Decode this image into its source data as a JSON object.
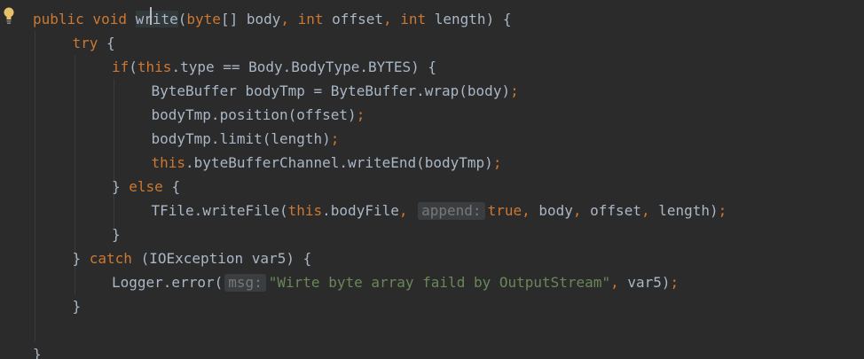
{
  "editor": {
    "lines": [
      {
        "indent": 0,
        "tokens": [
          {
            "t": "public void ",
            "c": "kw"
          },
          {
            "t": "write",
            "c": "hl"
          },
          {
            "t": "(",
            "c": ""
          },
          {
            "t": "byte",
            "c": "kw"
          },
          {
            "t": "[] body",
            "c": ""
          },
          {
            "t": ", ",
            "c": "kw"
          },
          {
            "t": "int ",
            "c": "kw"
          },
          {
            "t": "offset",
            "c": ""
          },
          {
            "t": ", ",
            "c": "kw"
          },
          {
            "t": "int ",
            "c": "kw"
          },
          {
            "t": "length) {",
            "c": ""
          }
        ]
      },
      {
        "indent": 1,
        "tokens": [
          {
            "t": "try ",
            "c": "kw"
          },
          {
            "t": "{",
            "c": ""
          }
        ]
      },
      {
        "indent": 2,
        "tokens": [
          {
            "t": "if",
            "c": "kw"
          },
          {
            "t": "(",
            "c": ""
          },
          {
            "t": "this",
            "c": "kw"
          },
          {
            "t": ".type == Body.BodyType.BYTES) {",
            "c": ""
          }
        ]
      },
      {
        "indent": 3,
        "tokens": [
          {
            "t": "ByteBuffer bodyTmp = ByteBuffer.wrap(body)",
            "c": ""
          },
          {
            "t": ";",
            "c": "kw"
          }
        ]
      },
      {
        "indent": 3,
        "tokens": [
          {
            "t": "bodyTmp.position(offset)",
            "c": ""
          },
          {
            "t": ";",
            "c": "kw"
          }
        ]
      },
      {
        "indent": 3,
        "tokens": [
          {
            "t": "bodyTmp.limit(length)",
            "c": ""
          },
          {
            "t": ";",
            "c": "kw"
          }
        ]
      },
      {
        "indent": 3,
        "tokens": [
          {
            "t": "this",
            "c": "kw"
          },
          {
            "t": ".byteBufferChannel.writeEnd(bodyTmp)",
            "c": ""
          },
          {
            "t": ";",
            "c": "kw"
          }
        ]
      },
      {
        "indent": 2,
        "tokens": [
          {
            "t": "} ",
            "c": ""
          },
          {
            "t": "else ",
            "c": "kw"
          },
          {
            "t": "{",
            "c": ""
          }
        ]
      },
      {
        "indent": 3,
        "tokens": [
          {
            "t": "TFile.writeFile(",
            "c": ""
          },
          {
            "t": "this",
            "c": "kw"
          },
          {
            "t": ".bodyFile",
            "c": ""
          },
          {
            "t": ", ",
            "c": "kw"
          },
          {
            "t": "append:",
            "c": "hint"
          },
          {
            "t": "true",
            "c": "kw"
          },
          {
            "t": ", ",
            "c": "kw"
          },
          {
            "t": "body",
            "c": ""
          },
          {
            "t": ", ",
            "c": "kw"
          },
          {
            "t": "offset",
            "c": ""
          },
          {
            "t": ", ",
            "c": "kw"
          },
          {
            "t": "length)",
            "c": ""
          },
          {
            "t": ";",
            "c": "kw"
          }
        ]
      },
      {
        "indent": 2,
        "tokens": [
          {
            "t": "}",
            "c": ""
          }
        ]
      },
      {
        "indent": 1,
        "tokens": [
          {
            "t": "} ",
            "c": ""
          },
          {
            "t": "catch ",
            "c": "kw"
          },
          {
            "t": "(IOException var5) {",
            "c": ""
          }
        ]
      },
      {
        "indent": 2,
        "tokens": [
          {
            "t": "Logger.error(",
            "c": ""
          },
          {
            "t": "msg:",
            "c": "hint"
          },
          {
            "t": "\"Wirte byte array faild by OutputStream\"",
            "c": "str"
          },
          {
            "t": ", ",
            "c": "kw"
          },
          {
            "t": "var5)",
            "c": ""
          },
          {
            "t": ";",
            "c": "kw"
          }
        ]
      },
      {
        "indent": 1,
        "tokens": [
          {
            "t": "}",
            "c": ""
          }
        ]
      },
      {
        "indent": 0,
        "tokens": []
      },
      {
        "indent": 0,
        "tokens": [
          {
            "t": "}",
            "c": ""
          }
        ]
      }
    ]
  },
  "colors": {
    "background": "#2b2b2b",
    "default_text": "#a9b7c6",
    "keyword": "#cc7832",
    "string": "#6a8759",
    "hint_bg": "#3b3e40",
    "hint_text": "#787878"
  },
  "icons": {
    "intention_bulb": "lightbulb-icon"
  }
}
